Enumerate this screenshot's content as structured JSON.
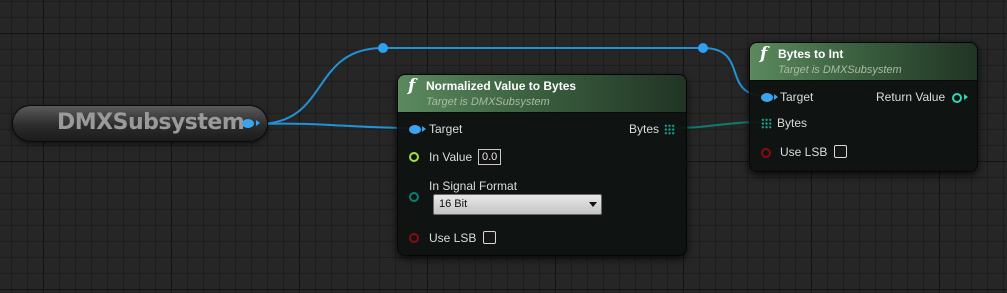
{
  "graph": {
    "variable_node": {
      "label": "DMXSubsystem"
    },
    "normalized_node": {
      "icon": "function-icon",
      "title": "Normalized Value to Bytes",
      "subtitle": "Target is DMXSubsystem",
      "pins": {
        "target": "Target",
        "in_value": "In Value",
        "in_value_value": "0.0",
        "in_signal_format": "In Signal Format",
        "signal_format_selected": "16 Bit",
        "use_lsb": "Use LSB",
        "bytes_out": "Bytes"
      }
    },
    "bytes_to_int_node": {
      "icon": "function-icon",
      "title": "Bytes to Int",
      "subtitle": "Target is DMXSubsystem",
      "pins": {
        "target": "Target",
        "bytes": "Bytes",
        "use_lsb": "Use LSB",
        "return_value": "Return Value"
      }
    }
  },
  "function_glyph": "f",
  "colors": {
    "object_pin": "#3aa4ee",
    "float_pin": "#9fe33f",
    "bool_pin": "#8a0b0b",
    "byte_array_pin": "#1a9b8c",
    "int_pin": "#2ed8b2",
    "function_header": "#3c6140"
  }
}
